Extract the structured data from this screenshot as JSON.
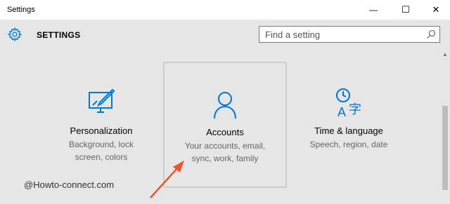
{
  "window": {
    "title": "Settings",
    "minimize_glyph": "—",
    "maximize_glyph": "☐",
    "close_glyph": "✕"
  },
  "header": {
    "title": "SETTINGS",
    "icon": "gear-icon"
  },
  "search": {
    "placeholder": "Find a setting",
    "icon": "search-icon"
  },
  "tiles": [
    {
      "name": "Personalization",
      "desc_line1": "Background, lock",
      "desc_line2": "screen, colors",
      "icon": "personalization-icon"
    },
    {
      "name": "Accounts",
      "desc_line1": "Your accounts, email,",
      "desc_line2": "sync, work, family",
      "icon": "person-icon",
      "selected": true
    },
    {
      "name": "Time & language",
      "desc_line1": "Speech, region, date",
      "desc_line2": "",
      "icon": "time-language-icon"
    }
  ],
  "watermark": "@Howto-connect.com",
  "colors": {
    "accent": "#0078d7",
    "background": "#e6e6e6",
    "arrow": "#e8552f"
  }
}
